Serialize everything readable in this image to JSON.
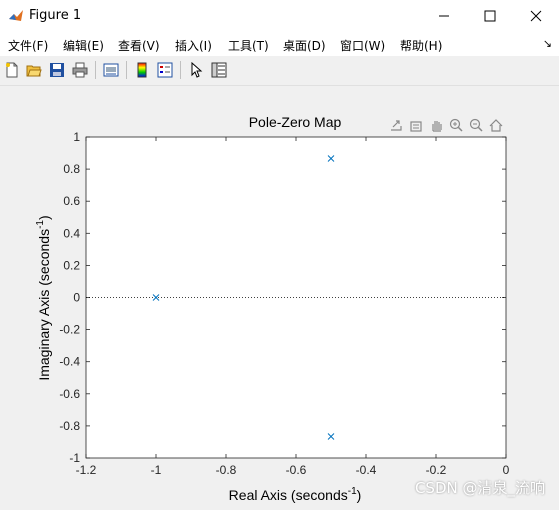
{
  "window": {
    "title": "Figure 1",
    "minimize_label": "minimize",
    "maximize_label": "maximize",
    "close_label": "close"
  },
  "menu": {
    "items": [
      "文件(F)",
      "编辑(E)",
      "查看(V)",
      "插入(I)",
      "工具(T)",
      "桌面(D)",
      "窗口(W)",
      "帮助(H)"
    ],
    "overflow": "↘"
  },
  "toolbar": {
    "icons": [
      "new-figure-icon",
      "open-file-icon",
      "save-icon",
      "print-icon",
      "print-preview-icon",
      "colorbar-icon",
      "legend-icon",
      "edit-plot-pointer-icon",
      "property-editor-icon"
    ]
  },
  "axes_toolbar": {
    "icons": [
      "export-icon",
      "brush-data-icon",
      "pan-hand-icon",
      "zoom-in-icon",
      "zoom-out-icon",
      "home-restore-view-icon"
    ]
  },
  "chart_data": {
    "type": "scatter",
    "title": "Pole-Zero Map",
    "xlabel": "Real Axis (seconds",
    "xlabel_sup": "-1",
    "xlabel_end": ")",
    "ylabel": "Imaginary Axis (seconds",
    "ylabel_sup": "-1",
    "ylabel_end": ")",
    "xlim": [
      -1.2,
      0
    ],
    "ylim": [
      -1,
      1
    ],
    "xticks": [
      -1.2,
      -1,
      -0.8,
      -0.6,
      -0.4,
      -0.2,
      0
    ],
    "xtick_labels": [
      "-1.2",
      "-1",
      "-0.8",
      "-0.6",
      "-0.4",
      "-0.2",
      "0"
    ],
    "yticks": [
      1,
      0.8,
      0.6,
      0.4,
      0.2,
      0,
      -0.2,
      -0.4,
      -0.6,
      -0.8,
      -1
    ],
    "ytick_labels": [
      "1",
      "0.8",
      "0.6",
      "0.4",
      "0.2",
      "0",
      "-0.2",
      "-0.4",
      "-0.6",
      "-0.8",
      "-1"
    ],
    "grid": false,
    "zero_line": true,
    "series": [
      {
        "marker": "x",
        "color": "#0072bd",
        "points": [
          {
            "x": -1,
            "y": 0
          },
          {
            "x": -0.5,
            "y": 0.866
          },
          {
            "x": -0.5,
            "y": -0.866
          }
        ]
      }
    ]
  },
  "watermark": "CSDN @清泉_流响"
}
